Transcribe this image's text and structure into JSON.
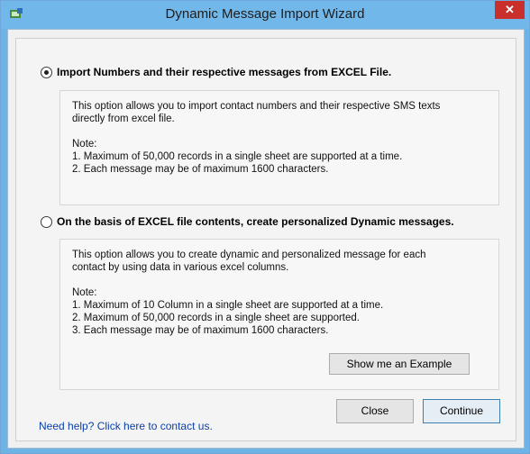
{
  "window": {
    "title": "Dynamic Message Import Wizard",
    "close_glyph": "✕"
  },
  "option1": {
    "label": "Import Numbers and their respective messages from EXCEL File.",
    "selected": true,
    "desc_line1": "This option allows you to import contact numbers and their respective SMS texts",
    "desc_line2": "directly from excel file.",
    "note_title": "Note:",
    "note1": "1. Maximum of 50,000 records in a single sheet are supported at a time.",
    "note2": "2. Each message may be of maximum 1600 characters."
  },
  "option2": {
    "label": "On the basis of EXCEL file contents, create personalized Dynamic messages.",
    "selected": false,
    "desc_line1": "This option allows you to create dynamic and personalized message for each",
    "desc_line2": "contact by using data in various excel columns.",
    "note_title": "Note:",
    "note1": "1. Maximum of 10 Column in a single sheet are supported at a time.",
    "note2": "2. Maximum of 50,000 records in a single sheet are supported.",
    "note3": "3. Each message may be of maximum 1600 characters.",
    "example_button": "Show me an Example"
  },
  "footer": {
    "help_link": "Need help? Click here to contact us.",
    "close_button": "Close",
    "continue_button": "Continue"
  },
  "colors": {
    "titlebar": "#72b7ea",
    "close_button": "#c9302c",
    "link": "#0b3fa8"
  }
}
